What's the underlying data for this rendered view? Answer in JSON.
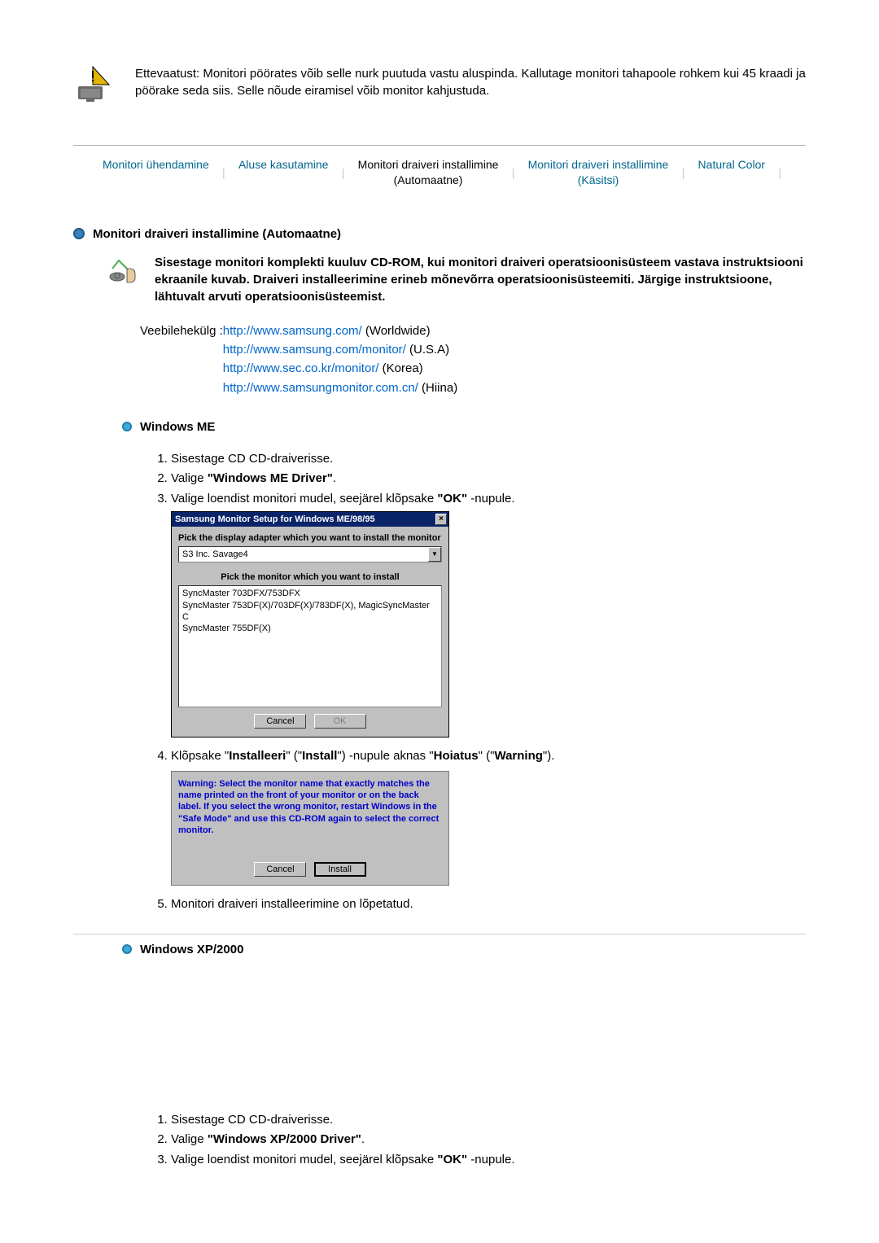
{
  "caution": {
    "text": "Ettevaatust: Monitori pöörates võib selle nurk puutuda vastu aluspinda. Kallutage monitori tahapoole rohkem kui 45 kraadi ja pöörake seda siis. Selle nõude eiramisel võib monitor kahjustuda."
  },
  "tabs": {
    "t1": "Monitori ühendamine",
    "t2": "Aluse kasutamine",
    "t3a": "Monitori draiveri installimine",
    "t3b": "(Automaatne)",
    "t4a": "Monitori draiveri installimine",
    "t4b": "(Käsitsi)",
    "t5": "Natural Color",
    "sep": "|"
  },
  "sect_title": "Monitori draiveri installimine (Automaatne)",
  "intro": "Sisestage monitori komplekti kuuluv CD-ROM, kui monitori draiveri operatsioonisüsteem vastava instruktsiooni ekraanile kuvab. Draiveri installeerimine erineb mõnevõrra operatsioonisüsteemiti. Järgige instruktsioone, lähtuvalt arvuti operatsioonisüsteemist.",
  "links": {
    "label": "Veebilehekülg :",
    "l1": "http://www.samsung.com/",
    "l1s": " (Worldwide)",
    "l2": "http://www.samsung.com/monitor/",
    "l2s": " (U.S.A)",
    "l3": "http://www.sec.co.kr/monitor/",
    "l3s": " (Korea)",
    "l4": "http://www.samsungmonitor.com.cn/",
    "l4s": " (Hiina)"
  },
  "me": {
    "heading": "Windows ME",
    "step1": "Sisestage CD CD-draiverisse.",
    "step2a": "Valige ",
    "step2b": "\"Windows ME Driver\"",
    "step2c": ".",
    "step3a": "Valige loendist monitori mudel, seejärel klõpsake ",
    "step3b": "\"OK\"",
    "step3c": " -nupule.",
    "dlg": {
      "title": "Samsung Monitor Setup for Windows ME/98/95",
      "label_adapter": "Pick the display adapter which you want to install the monitor",
      "adapter_value": "S3 Inc. Savage4",
      "label_monitor": "Pick the monitor which you want to install",
      "m1": "SyncMaster 703DFX/753DFX",
      "m2": "SyncMaster 753DF(X)/703DF(X)/783DF(X), MagicSyncMaster C",
      "m3": "SyncMaster 755DF(X)",
      "cancel": "Cancel",
      "ok": "OK"
    },
    "step4a": "Klõpsake \"",
    "step4b": "Installeeri",
    "step4c": "\" (\"",
    "step4d": "Install",
    "step4e": "\") -nupule aknas \"",
    "step4f": "Hoiatus",
    "step4g": "\" (\"",
    "step4h": "Warning",
    "step4i": "\").",
    "dlg2": {
      "warn": "Warning: Select the monitor name that exactly matches the name printed on the front of your monitor or on the back label. If you select the wrong monitor, restart Windows in the \"Safe Mode\" and use this CD-ROM again to select the correct monitor.",
      "cancel": "Cancel",
      "install": "Install"
    },
    "step5": "Monitori draiveri installeerimine on lõpetatud."
  },
  "xp": {
    "heading": "Windows XP/2000",
    "step1": "Sisestage CD CD-draiverisse.",
    "step2a": "Valige ",
    "step2b": "\"Windows XP/2000 Driver\"",
    "step2c": ".",
    "step3a": "Valige loendist monitori mudel, seejärel klõpsake ",
    "step3b": "\"OK\"",
    "step3c": " -nupule."
  }
}
